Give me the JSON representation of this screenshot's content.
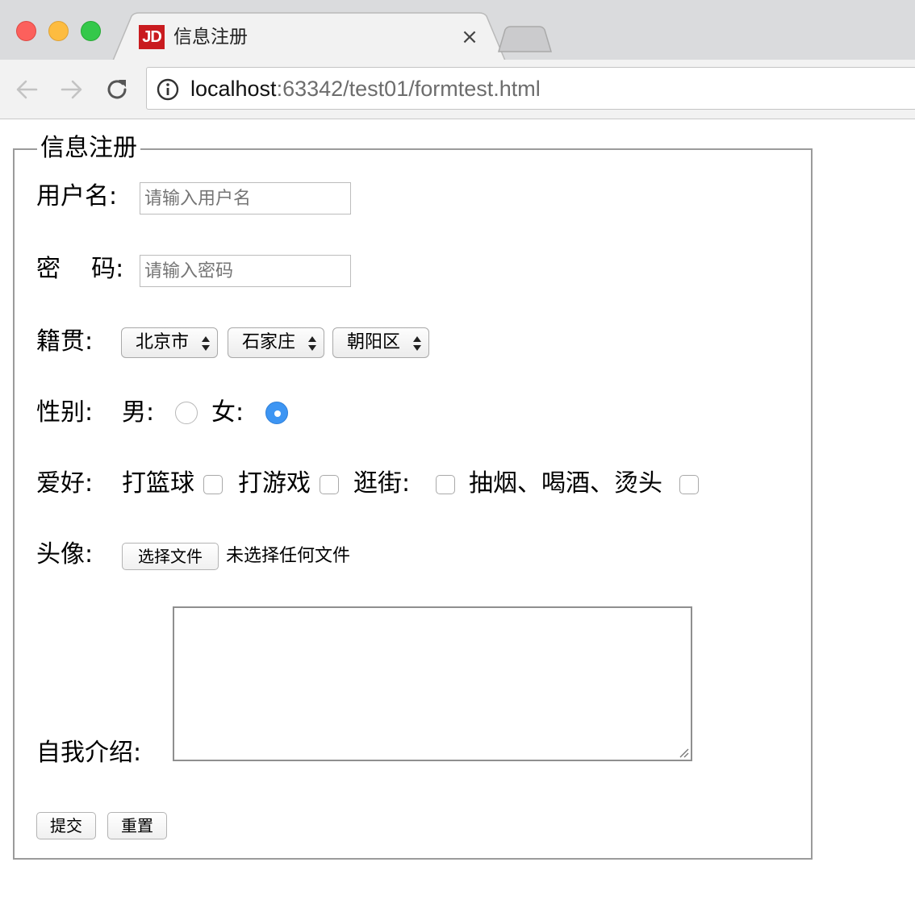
{
  "browser": {
    "tab": {
      "favicon_text": "JD",
      "title": "信息注册",
      "close_glyph": "×"
    },
    "address": {
      "host": "localhost",
      "rest": ":63342/test01/formtest.html"
    },
    "icons": {
      "back": "arrow-left-icon",
      "forward": "arrow-right-icon",
      "reload": "reload-icon",
      "info": "info-icon"
    }
  },
  "form": {
    "legend": "信息注册",
    "username": {
      "label": "用户名:",
      "placeholder": "请输入用户名",
      "value": ""
    },
    "password": {
      "label": "密    码:",
      "placeholder": "请输入密码",
      "value": ""
    },
    "hometown": {
      "label": "籍贯:",
      "province": "北京市",
      "city": "石家庄",
      "district": "朝阳区"
    },
    "gender": {
      "label": "性别:",
      "male_label": "男:",
      "female_label": "女:",
      "selected": "female"
    },
    "hobbies": {
      "label": "爱好:",
      "items": [
        {
          "label": "打篮球",
          "checked": false
        },
        {
          "label": "打游戏",
          "checked": false
        },
        {
          "label": "逛街:",
          "checked": false
        },
        {
          "label": "抽烟、喝酒、烫头",
          "checked": false
        }
      ]
    },
    "avatar": {
      "label": "头像:",
      "button_label": "选择文件",
      "status": "未选择任何文件"
    },
    "intro": {
      "label": "自我介绍:",
      "value": ""
    },
    "submit_label": "提交",
    "reset_label": "重置"
  },
  "colors": {
    "radio_selected": "#3d95f3",
    "favicon_bg": "#c91b1f",
    "traffic_red": "#fc605c",
    "traffic_yellow": "#fdbc40",
    "traffic_green": "#34c84a"
  }
}
